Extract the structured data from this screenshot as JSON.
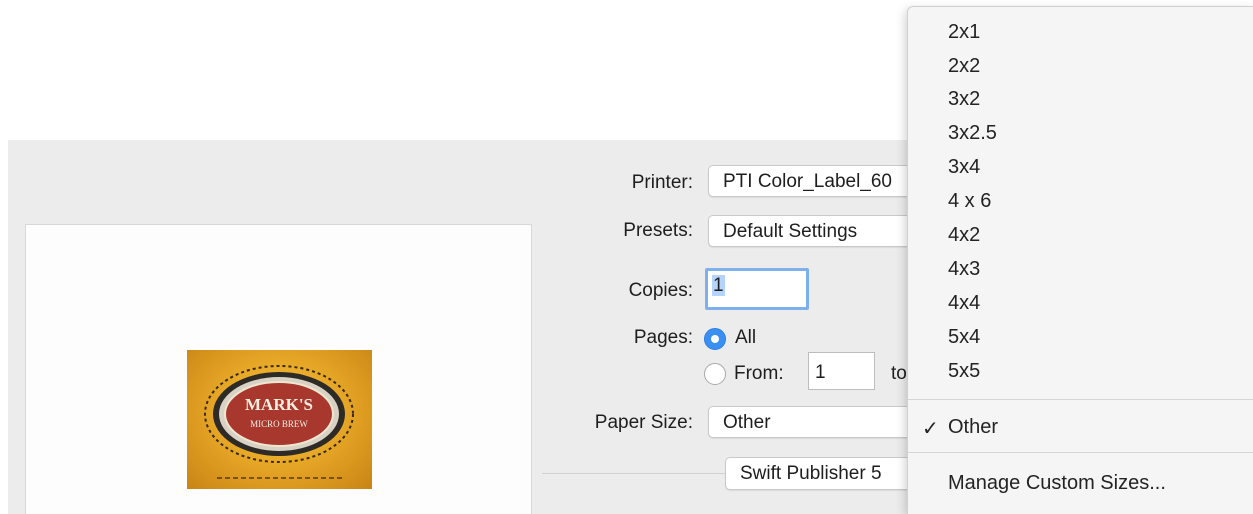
{
  "print_dialog": {
    "printer_label": "Printer:",
    "printer_value": "PTI Color_Label_60",
    "presets_label": "Presets:",
    "presets_value": "Default Settings",
    "copies_label": "Copies:",
    "copies_value": "1",
    "pages_label": "Pages:",
    "pages_all": "All",
    "pages_from": "From:",
    "pages_from_value": "1",
    "pages_to": "to",
    "paper_size_label": "Paper Size:",
    "paper_size_value": "Other",
    "app_section_value": "Swift Publisher 5"
  },
  "preview": {
    "label_title_line1": "MARK'S",
    "label_title_line2": "MICRO BREW"
  },
  "paper_size_menu": {
    "items": [
      "2x1",
      "2x2",
      "3x2",
      "3x2.5",
      "3x4",
      "4 x 6",
      "4x2",
      "4x3",
      "4x4",
      "5x4",
      "5x5"
    ],
    "selected": "Other",
    "manage": "Manage Custom Sizes..."
  },
  "colors": {
    "accent": "#3b8ff3",
    "focus_ring": "#7fb0ee",
    "label_gold": "#e8a928",
    "label_oval": "#a8372e"
  }
}
